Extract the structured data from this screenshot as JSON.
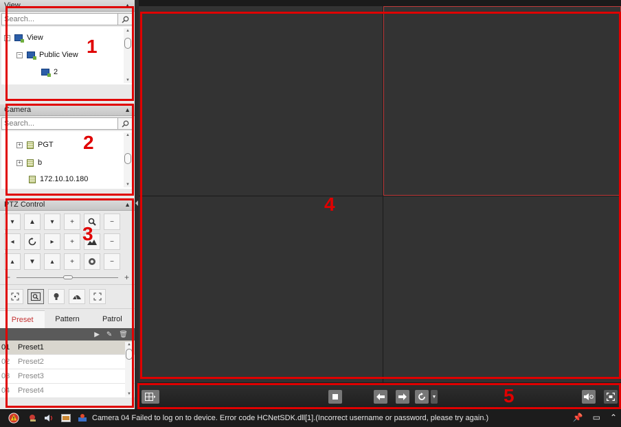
{
  "view_panel": {
    "title": "View",
    "search_placeholder": "Search...",
    "tree": [
      {
        "label": "View"
      },
      {
        "label": "Public View"
      },
      {
        "label": "2"
      }
    ]
  },
  "camera_panel": {
    "title": "Camera",
    "search_placeholder": "Search...",
    "tree": [
      {
        "label": "PGT"
      },
      {
        "label": "b"
      },
      {
        "label": "172.10.10.180"
      }
    ]
  },
  "ptz_panel": {
    "title": "PTZ Control",
    "tabs": [
      {
        "label": "Preset",
        "active": true
      },
      {
        "label": "Pattern",
        "active": false
      },
      {
        "label": "Patrol",
        "active": false
      }
    ],
    "presets": [
      {
        "num": "01",
        "name": "Preset1",
        "selected": true
      },
      {
        "num": "02",
        "name": "Preset2",
        "selected": false
      },
      {
        "num": "03",
        "name": "Preset3",
        "selected": false
      },
      {
        "num": "04",
        "name": "Preset4",
        "selected": false
      }
    ]
  },
  "status_bar": {
    "message": "Camera 04 Failed to log on to device. Error code HCNetSDK.dll[1].(Incorrect username or password, please try again.)"
  },
  "annotations": {
    "n1": "1",
    "n2": "2",
    "n3": "3",
    "n4": "4",
    "n5": "5"
  },
  "colors": {
    "annotation": "#e00000",
    "selected_window_border": "#c23c3c",
    "active_tab": "#c43232"
  }
}
